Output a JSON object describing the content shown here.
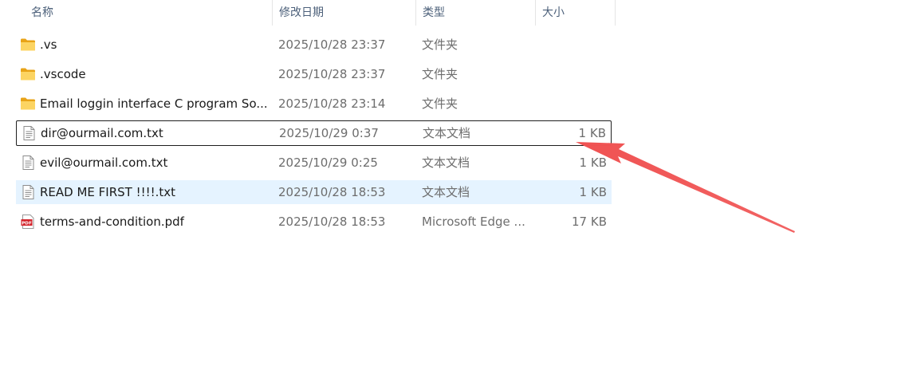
{
  "columns": {
    "name": "名称",
    "date": "修改日期",
    "type": "类型",
    "size": "大小"
  },
  "files": [
    {
      "name": ".vs",
      "date": "2025/10/28 23:37",
      "type": "文件夹",
      "size": "",
      "icon": "folder-icon"
    },
    {
      "name": ".vscode",
      "date": "2025/10/28 23:37",
      "type": "文件夹",
      "size": "",
      "icon": "folder-icon"
    },
    {
      "name": "Email loggin interface C program So...",
      "date": "2025/10/28 23:14",
      "type": "文件夹",
      "size": "",
      "icon": "folder-icon"
    },
    {
      "name": "dir@ourmail.com.txt",
      "date": "2025/10/29 0:37",
      "type": "文本文档",
      "size": "1 KB",
      "icon": "text-file-icon"
    },
    {
      "name": "evil@ourmail.com.txt",
      "date": "2025/10/29 0:25",
      "type": "文本文档",
      "size": "1 KB",
      "icon": "text-file-icon"
    },
    {
      "name": "READ ME FIRST !!!!.txt",
      "date": "2025/10/28 18:53",
      "type": "文本文档",
      "size": "1 KB",
      "icon": "text-file-icon"
    },
    {
      "name": "terms-and-condition.pdf",
      "date": "2025/10/28 18:53",
      "type": "Microsoft Edge ...",
      "size": "17 KB",
      "icon": "pdf-file-icon"
    }
  ],
  "colors": {
    "selection": "#e5f3ff",
    "arrow": "#f05252",
    "folder": "#f8c94a"
  }
}
